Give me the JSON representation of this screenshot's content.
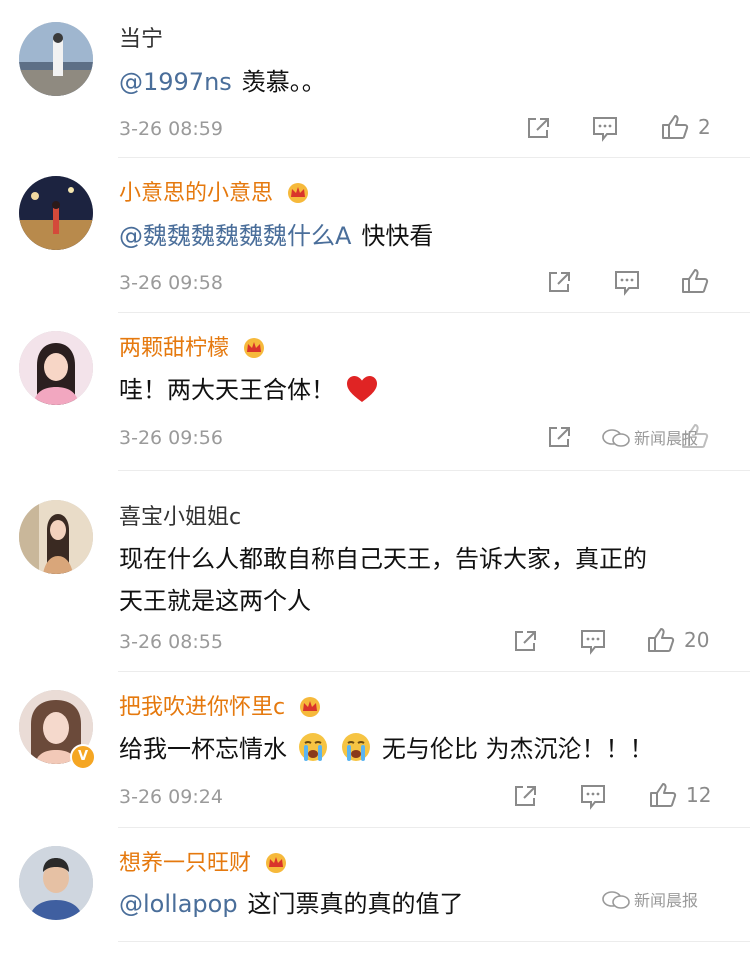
{
  "comments": [
    {
      "name": "当宁",
      "mention": "@1997ns",
      "text": "羡慕。。",
      "time": "3-26 08:59",
      "likes": "2"
    },
    {
      "name": "小意思的小意思",
      "mention": "@魏魏魏魏魏魏什么A",
      "text": "快快看",
      "time": "3-26 09:58",
      "likes": ""
    },
    {
      "name": "两颗甜柠檬",
      "text_a": "哇！两大天王合体！",
      "time": "3-26 09:56",
      "likes": ""
    },
    {
      "name": "喜宝小姐姐c",
      "line1": "现在什么人都敢自称自己天王，告诉大家，真正的",
      "line2": "天王就是这两个人",
      "time": "3-26 08:55",
      "likes": "20"
    },
    {
      "name": "把我吹进你怀里c",
      "text_a": "给我一杯忘情水",
      "text_b": "无与伦比 为杰沉沦！！！",
      "time": "3-26 09:24",
      "likes": "12"
    },
    {
      "name": "想养一只旺财",
      "mention": "@lollapop",
      "text": "这门票真的真的值了"
    }
  ],
  "watermark": "新闻晨报",
  "colors": {
    "vip_name": "#e5790e",
    "mention": "#4a6e9a",
    "meta": "#9a9a9a"
  },
  "icons": [
    "share-icon",
    "comment-icon",
    "like-icon",
    "crown-icon",
    "verified-badge-icon",
    "heart-emoji",
    "crying-emoji"
  ]
}
